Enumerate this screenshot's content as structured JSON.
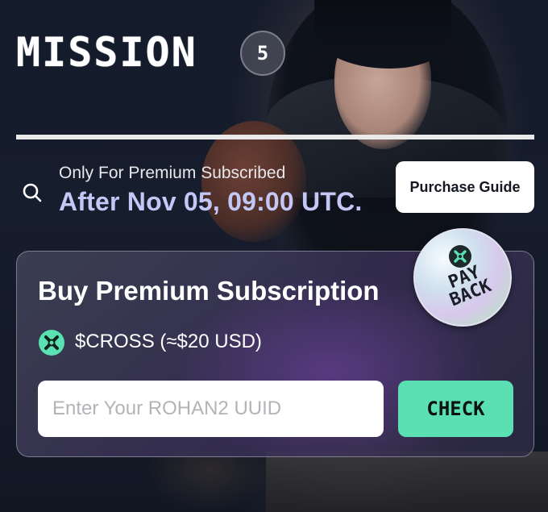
{
  "header": {
    "title": "MISSION",
    "badge": "5"
  },
  "notice": {
    "icon": "search-icon",
    "subtitle": "Only For Premium Subscribed",
    "date": "After Nov 05, 09:00 UTC.",
    "guide_button": "Purchase Guide"
  },
  "card": {
    "title": "Buy Premium Subscription",
    "token_icon": "cross-token-icon",
    "price": "$CROSS (≈$20 USD)",
    "input_placeholder": "Enter Your ROHAN2 UUID",
    "input_value": "",
    "check_button": "CHECK",
    "sticker": {
      "line1": "PAY",
      "line2": "BACK"
    }
  },
  "colors": {
    "accent_green": "#5ae0b3",
    "date_lavender": "#c2c7f5",
    "background": "#141b2b"
  }
}
